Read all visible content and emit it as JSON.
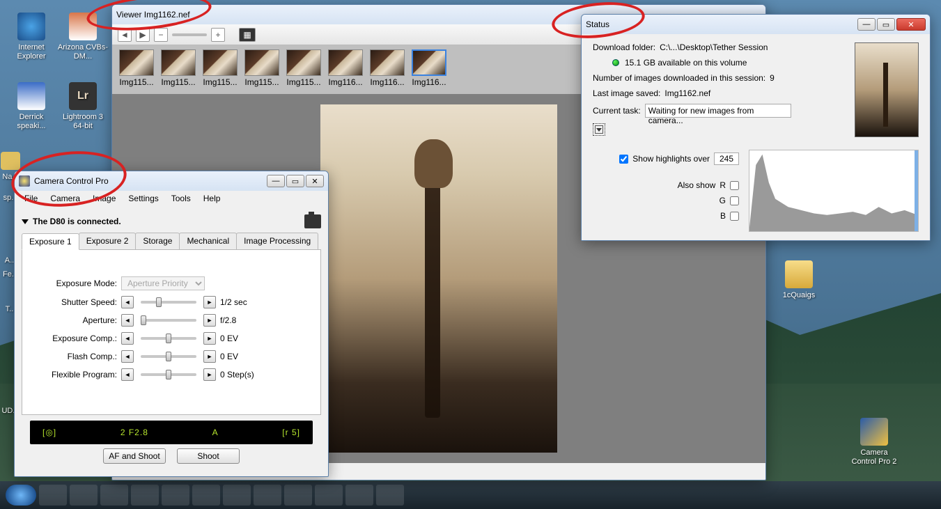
{
  "desktop": {
    "icons": [
      {
        "label": "Internet Explorer"
      },
      {
        "label": "Arizona CVBs-DM..."
      },
      {
        "label": "Derrick speaki..."
      },
      {
        "label": "Lightroom 3 64-bit"
      },
      {
        "label": "Na..."
      },
      {
        "label": "sp..."
      },
      {
        "label": "A..."
      },
      {
        "label": "Fe..."
      },
      {
        "label": "T..."
      },
      {
        "label": "UD..."
      },
      {
        "label": "1cQuaigs"
      },
      {
        "label": "Camera Control Pro 2"
      }
    ]
  },
  "viewer": {
    "title": "Viewer Img1162.nef",
    "thumbs": [
      {
        "label": "Img115..."
      },
      {
        "label": "Img115..."
      },
      {
        "label": "Img115..."
      },
      {
        "label": "Img115..."
      },
      {
        "label": "Img115..."
      },
      {
        "label": "Img116..."
      },
      {
        "label": "Img116..."
      },
      {
        "label": "Img116..."
      }
    ]
  },
  "ccp": {
    "title": "Camera Control Pro",
    "menu": [
      "File",
      "Camera",
      "Image",
      "Settings",
      "Tools",
      "Help"
    ],
    "status_line": "The D80 is connected.",
    "tabs": [
      "Exposure 1",
      "Exposure 2",
      "Storage",
      "Mechanical",
      "Image Processing"
    ],
    "rows": {
      "exposure_mode": {
        "label": "Exposure Mode:",
        "value": "Aperture Priority"
      },
      "shutter_speed": {
        "label": "Shutter Speed:",
        "value": "1/2 sec"
      },
      "aperture": {
        "label": "Aperture:",
        "value": "f/2.8"
      },
      "exposure_comp": {
        "label": "Exposure Comp.:",
        "value": "0 EV"
      },
      "flash_comp": {
        "label": "Flash Comp.:",
        "value": "0 EV"
      },
      "flex_program": {
        "label": "Flexible Program:",
        "value": "0 Step(s)"
      }
    },
    "readout": {
      "focus": "[◎]",
      "main": "2 F2.8",
      "mode": "A",
      "frames": "[r  5]"
    },
    "buttons": {
      "af_shoot": "AF and Shoot",
      "shoot": "Shoot"
    }
  },
  "status": {
    "title": "Status",
    "dl_label": "Download folder:",
    "dl_path": "C:\\...\\Desktop\\Tether Session",
    "space": "15.1 GB  available on this volume",
    "count_label": "Number of images downloaded in this session:",
    "count_value": "9",
    "last_label": "Last image saved:",
    "last_value": "Img1162.nef",
    "task_label": "Current task:",
    "task_value": "Waiting for new images from camera...",
    "highlights_label": "Show highlights over",
    "highlights_value": "245",
    "also_show": "Also show",
    "channels": [
      "R",
      "G",
      "B"
    ]
  },
  "chart_data": {
    "type": "area",
    "title": "",
    "xlabel": "",
    "ylabel": "",
    "xlim": [
      0,
      255
    ],
    "ylim": [
      0,
      100
    ],
    "x": [
      0,
      8,
      16,
      24,
      32,
      48,
      64,
      80,
      96,
      112,
      128,
      144,
      160,
      176,
      192,
      208,
      224,
      240,
      255
    ],
    "values": [
      5,
      82,
      95,
      60,
      40,
      30,
      26,
      22,
      20,
      22,
      24,
      20,
      30,
      22,
      26,
      20,
      24,
      18,
      28
    ]
  }
}
